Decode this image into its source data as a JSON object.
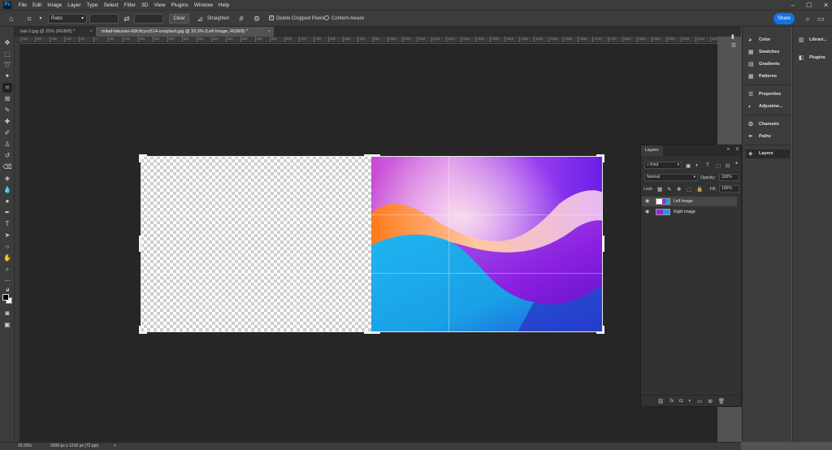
{
  "menu": [
    "File",
    "Edit",
    "Image",
    "Layer",
    "Type",
    "Select",
    "Filter",
    "3D",
    "View",
    "Plugins",
    "Window",
    "Help"
  ],
  "options": {
    "ratio": "Ratio",
    "clear": "Clear",
    "straighten": "Straighten",
    "delete_cropped": "Delete Cropped Pixels",
    "content_aware": "Content-Aware",
    "share": "Share"
  },
  "tabs": [
    {
      "label": "bali-3.jpg @ 25% (RGB/8) *",
      "close": "×"
    },
    {
      "label": "milad-fakurian-E8Ufcyxz514-unsplash.jpg @ 33.3% (Left Image, RGB/8) *",
      "close": "×"
    }
  ],
  "ruler_labels": [
    "250",
    "200",
    "150",
    "100",
    "50",
    "0",
    "50",
    "100",
    "150",
    "200",
    "250",
    "300",
    "350",
    "400",
    "450",
    "500",
    "550",
    "600",
    "650",
    "700",
    "750",
    "800",
    "850",
    "900",
    "950",
    "1000",
    "1050",
    "1100",
    "1150",
    "1200",
    "1250",
    "1300",
    "1350",
    "1400",
    "1450",
    "1500",
    "1550",
    "1600",
    "1650",
    "1700",
    "1750",
    "1800",
    "1850",
    "1900",
    "1950",
    "2000",
    "2050",
    "2100",
    "2150",
    "2200",
    "2250",
    "2300",
    "2350",
    "2400",
    "2450",
    "2500",
    "2550",
    "2600",
    "2650",
    "2700",
    "2750",
    "2800",
    "2850",
    "2900",
    "2950",
    "3000",
    "3050",
    "3100",
    "3150",
    "3200",
    "3250",
    "3300",
    "3350",
    "3400",
    "3450",
    "3500"
  ],
  "layers_panel": {
    "title": "Layers",
    "kind": "Kind",
    "blend_mode": "Normal",
    "opacity_label": "Opacity:",
    "opacity_value": "100%",
    "lock_label": "Lock:",
    "fill_label": "Fill:",
    "fill_value": "100%",
    "layers": [
      {
        "name": "Left Image",
        "selected": true
      },
      {
        "name": "Right Image",
        "selected": false
      }
    ]
  },
  "dock": {
    "group1": [
      "Color",
      "Swatches",
      "Gradients",
      "Patterns"
    ],
    "group2": [
      "Properties",
      "Adjustme..."
    ],
    "group3": [
      "Channels",
      "Paths"
    ],
    "group4": [
      "Layers"
    ],
    "libraries": [
      "Librari...",
      "Plugins"
    ]
  },
  "status": {
    "zoom": "33.33%",
    "size": "3200 px x 1216 px (72 ppi)",
    "arrow": ">"
  },
  "colors": {
    "accent": "#1473e6",
    "foreground": "#000000",
    "background": "#ffffff"
  }
}
